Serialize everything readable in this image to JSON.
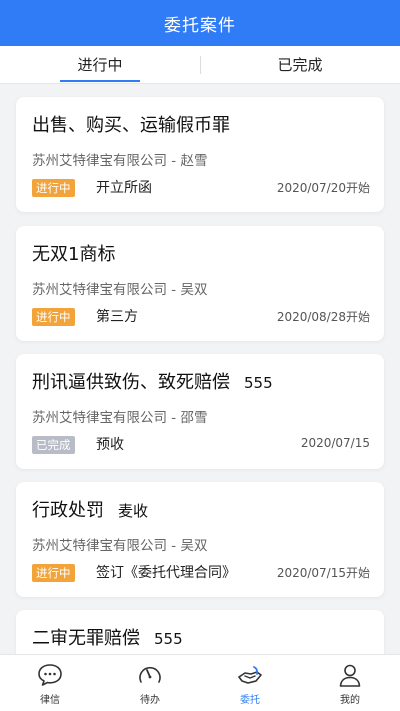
{
  "header": {
    "title": "委托案件"
  },
  "tabs": [
    {
      "label": "进行中",
      "active": true
    },
    {
      "label": "已完成",
      "active": false
    }
  ],
  "colors": {
    "primary": "#2f7cf6",
    "status_in_progress": "#f2a33a",
    "status_completed": "#b8bcc6"
  },
  "cases": [
    {
      "title": "出售、购买、运输假币罪",
      "extra": "",
      "company": "苏州艾特律宝有限公司 - 赵雪",
      "status": "进行中",
      "status_type": "in_progress",
      "stage": "开立所函",
      "date": "2020/07/20开始"
    },
    {
      "title": "无双1商标",
      "extra": "",
      "company": "苏州艾特律宝有限公司 - 吴双",
      "status": "进行中",
      "status_type": "in_progress",
      "stage": "第三方",
      "date": "2020/08/28开始"
    },
    {
      "title": "刑讯逼供致伤、致死赔偿",
      "extra": "555",
      "company": "苏州艾特律宝有限公司 - 邵雪",
      "status": "已完成",
      "status_type": "completed",
      "stage": "预收",
      "date": "2020/07/15"
    },
    {
      "title": "行政处罚",
      "extra": "麦收",
      "company": "苏州艾特律宝有限公司 - 吴双",
      "status": "进行中",
      "status_type": "in_progress",
      "stage": "签订《委托代理合同》",
      "date": "2020/07/15开始"
    },
    {
      "title": "二审无罪赔偿",
      "extra": "555",
      "company": "",
      "status": "",
      "status_type": "",
      "stage": "",
      "date": ""
    }
  ],
  "bottom_nav": [
    {
      "label": "律信",
      "icon": "chat-icon",
      "active": false
    },
    {
      "label": "待办",
      "icon": "gauge-icon",
      "active": false
    },
    {
      "label": "委托",
      "icon": "handshake-icon",
      "active": true
    },
    {
      "label": "我的",
      "icon": "user-icon",
      "active": false
    }
  ]
}
